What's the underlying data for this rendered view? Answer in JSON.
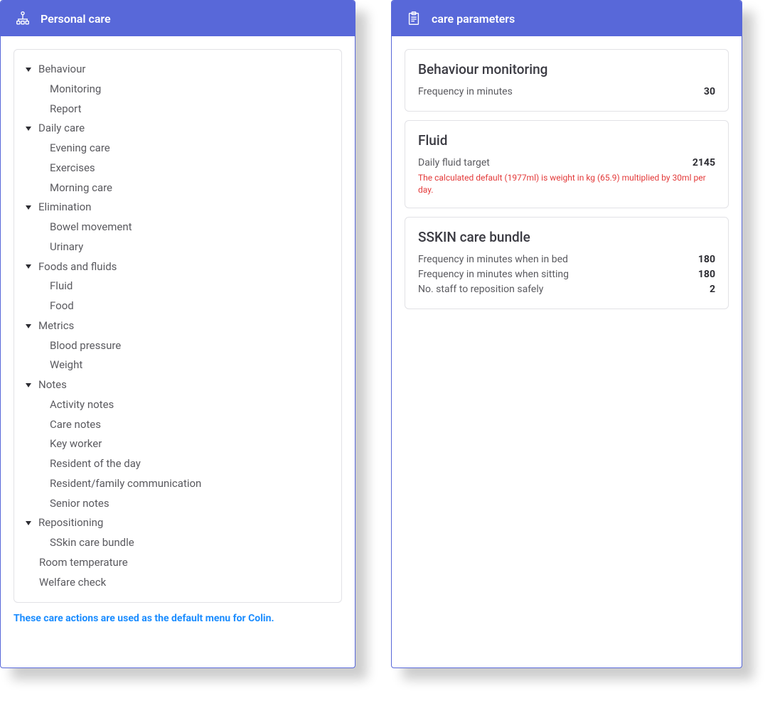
{
  "left_panel": {
    "title": "Personal care",
    "tree": [
      {
        "label": "Behaviour",
        "children": [
          "Monitoring",
          "Report"
        ]
      },
      {
        "label": "Daily care",
        "children": [
          "Evening care",
          "Exercises",
          "Morning care"
        ]
      },
      {
        "label": "Elimination",
        "children": [
          "Bowel movement",
          "Urinary"
        ]
      },
      {
        "label": "Foods and fluids",
        "children": [
          "Fluid",
          "Food"
        ]
      },
      {
        "label": "Metrics",
        "children": [
          "Blood pressure",
          "Weight"
        ]
      },
      {
        "label": "Notes",
        "children": [
          "Activity notes",
          "Care notes",
          "Key worker",
          "Resident of the day",
          "Resident/family communication",
          "Senior notes"
        ]
      },
      {
        "label": "Repositioning",
        "children": [
          "SSkin care bundle"
        ]
      },
      {
        "label": "Room temperature",
        "children": []
      },
      {
        "label": "Welfare check",
        "children": []
      }
    ],
    "footer_note": "These care actions are used as the default menu for Colin."
  },
  "right_panel": {
    "title": "care parameters",
    "cards": [
      {
        "title": "Behaviour monitoring",
        "rows": [
          {
            "label": "Frequency in minutes",
            "value": "30"
          }
        ],
        "note": ""
      },
      {
        "title": "Fluid",
        "rows": [
          {
            "label": "Daily fluid target",
            "value": "2145"
          }
        ],
        "note": "The calculated default (1977ml) is weight in kg (65.9) multiplied by 30ml per day."
      },
      {
        "title": "SSKIN care bundle",
        "rows": [
          {
            "label": "Frequency in minutes when in bed",
            "value": "180"
          },
          {
            "label": "Frequency in minutes when sitting",
            "value": "180"
          },
          {
            "label": "No. staff to reposition safely",
            "value": "2"
          }
        ],
        "note": ""
      }
    ]
  }
}
